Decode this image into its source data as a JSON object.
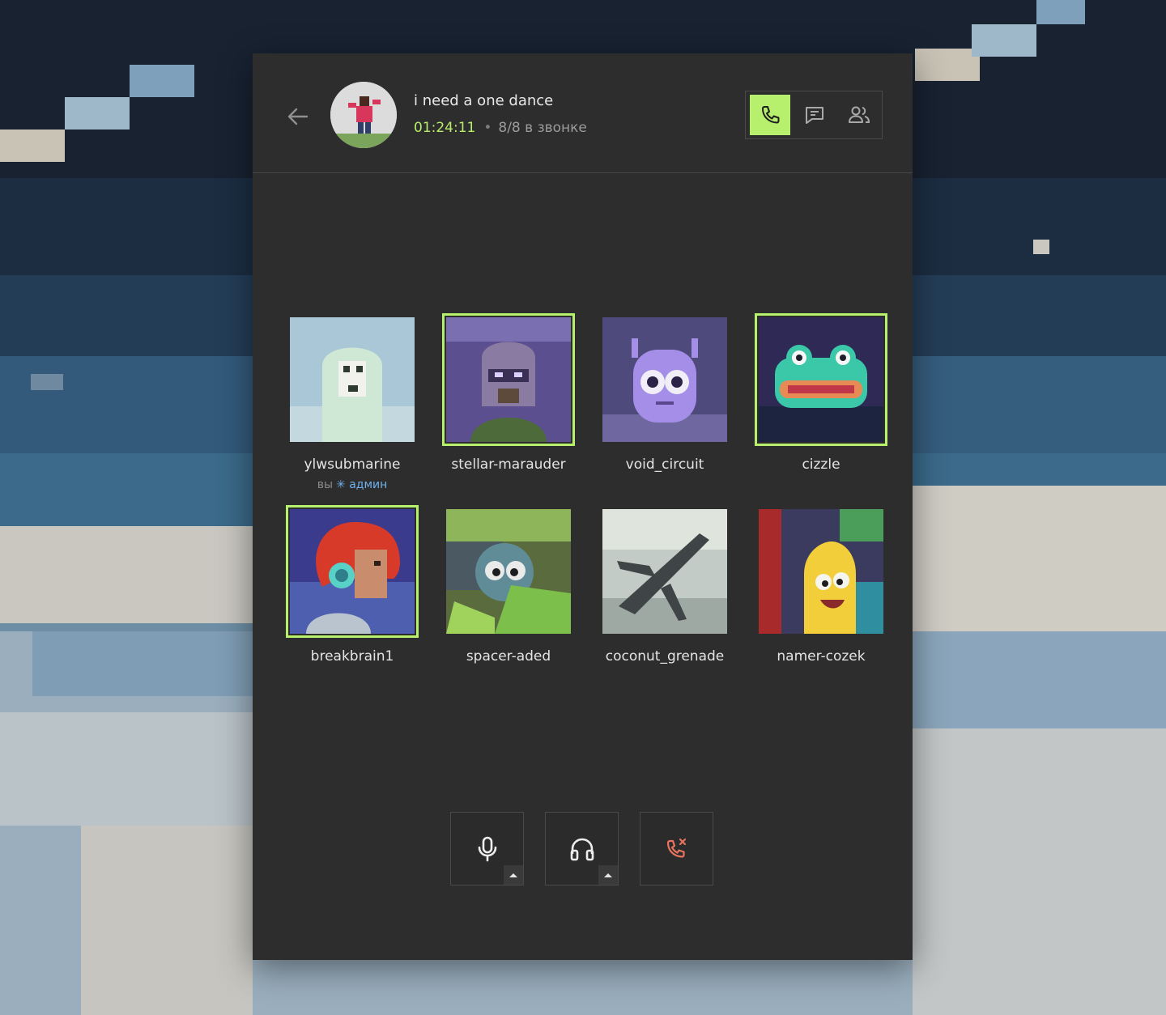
{
  "call": {
    "title": "i need a one dance",
    "timer": "01:24:11",
    "separator": "•",
    "participants_text": "8/8 в звонке"
  },
  "modes": [
    {
      "name": "call-mode",
      "icon": "phone-icon",
      "active": true
    },
    {
      "name": "chat-mode",
      "icon": "chat-icon",
      "active": false
    },
    {
      "name": "members-mode",
      "icon": "users-icon",
      "active": false
    }
  ],
  "participants": [
    {
      "username": "ylwsubmarine",
      "you_label": "вы",
      "role_icon": "✳",
      "role": "админ",
      "speaking": false
    },
    {
      "username": "stellar-marauder",
      "speaking": true
    },
    {
      "username": "void_circuit",
      "speaking": false
    },
    {
      "username": "cizzle",
      "speaking": true
    },
    {
      "username": "breakbrain1",
      "speaking": true
    },
    {
      "username": "spacer-aded",
      "speaking": false
    },
    {
      "username": "coconut_grenade",
      "speaking": false
    },
    {
      "username": "namer-cozek",
      "speaking": false
    }
  ],
  "controls": [
    {
      "name": "microphone-button",
      "icon": "microphone-icon"
    },
    {
      "name": "headphones-button",
      "icon": "headphones-icon"
    },
    {
      "name": "leave-call-button",
      "icon": "phone-hangup-icon"
    }
  ],
  "colors": {
    "accent": "#b7f06c",
    "panel": "#2d2d2d",
    "admin": "#6eb1ec",
    "danger": "#e8735f"
  }
}
